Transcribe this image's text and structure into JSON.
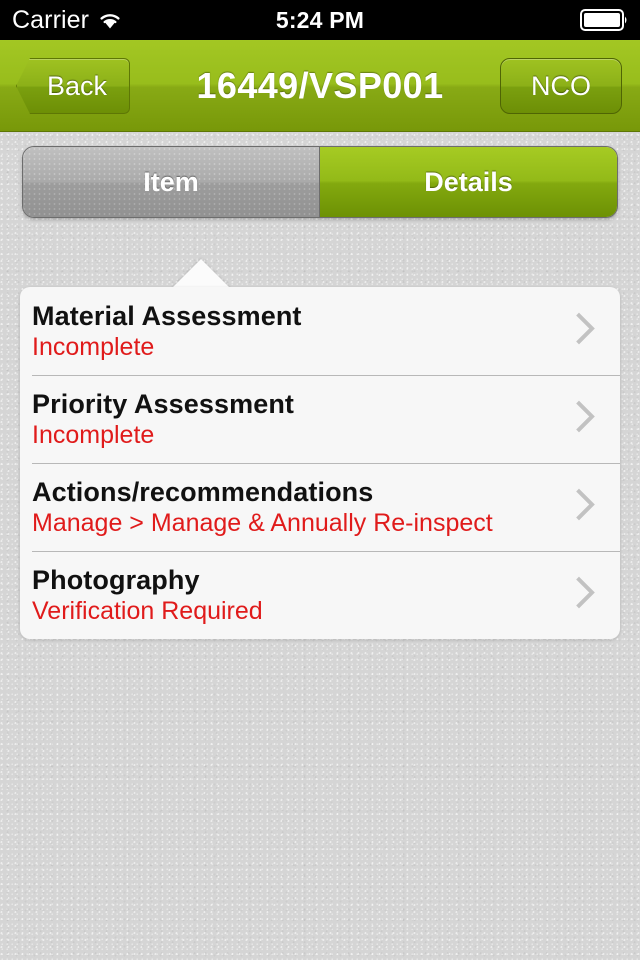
{
  "status_bar": {
    "carrier": "Carrier",
    "wifi_icon": "wifi-icon",
    "time": "5:24 PM",
    "battery_icon": "battery-full-icon"
  },
  "nav_bar": {
    "back_label": "Back",
    "title": "16449/VSP001",
    "right_label": "NCO",
    "accent_color": "#98bd1c"
  },
  "segmented_control": {
    "segments": [
      {
        "label": "Item",
        "selected": false
      },
      {
        "label": "Details",
        "selected": true
      }
    ]
  },
  "list": {
    "rows": [
      {
        "title": "Material Assessment",
        "status": "Incomplete",
        "status_color": "#e01b1b",
        "accessory": "chevron-right-icon"
      },
      {
        "title": "Priority Assessment",
        "status": "Incomplete",
        "status_color": "#e01b1b",
        "accessory": "chevron-right-icon"
      },
      {
        "title": "Actions/recommendations",
        "status": "Manage > Manage & Annually Re-inspect",
        "status_color": "#e01b1b",
        "accessory": "chevron-right-icon"
      },
      {
        "title": "Photography",
        "status": "Verification Required",
        "status_color": "#e01b1b",
        "accessory": "chevron-right-icon"
      }
    ]
  }
}
